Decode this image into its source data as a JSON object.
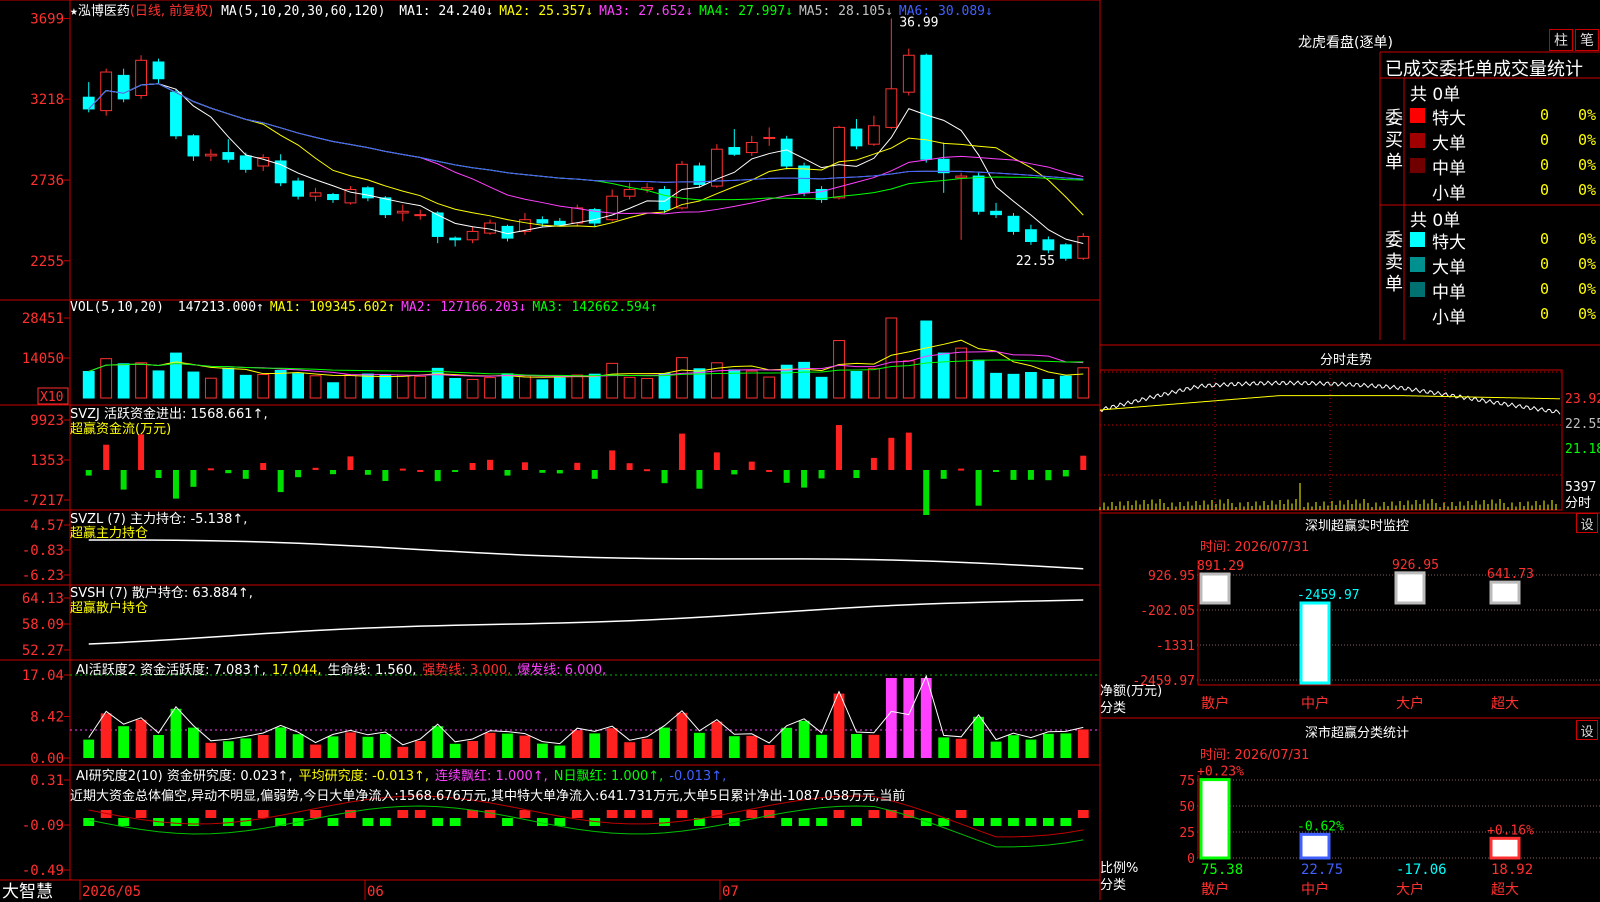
{
  "app_name": "大智慧",
  "main_chart": {
    "title_star": "★",
    "stock_name": "泓博医药",
    "period": "(日线, 前复权)",
    "ma_label": "MA(5,10,20,30,60,120)",
    "ma_values": [
      {
        "label": "MA1: 24.240↓",
        "color": "#ffffff"
      },
      {
        "label": "MA2: 25.357↓",
        "color": "#ffff00"
      },
      {
        "label": "MA3: 27.652↓",
        "color": "#ff40ff"
      },
      {
        "label": "MA4: 27.997↓",
        "color": "#00ff00"
      },
      {
        "label": "MA5: 28.105↓",
        "color": "#c0c0c0"
      },
      {
        "label": "MA6: 30.089↓",
        "color": "#4060ff"
      }
    ],
    "y_ticks": [
      "3699",
      "3218",
      "2736",
      "2255"
    ],
    "high_marker": "36.99",
    "low_marker": "22.55"
  },
  "volume_panel": {
    "label": "VOL(5,10,20)",
    "values": [
      {
        "label": "147213.000↑",
        "color": "#ffffff"
      },
      {
        "label": "MA1: 109345.602↑",
        "color": "#ffff00"
      },
      {
        "label": "MA2: 127166.203↓",
        "color": "#ff40ff"
      },
      {
        "label": "MA3: 142662.594↑",
        "color": "#00ff00"
      }
    ],
    "y_ticks": [
      "28451",
      "14050"
    ],
    "unit_badge": "X10"
  },
  "svzj_panel": {
    "label": "SVZJ  活跃资金进出: 1568.661↑,",
    "sub": "超赢资金流(万元)",
    "y_ticks": [
      "9923",
      "1353",
      "-7217"
    ]
  },
  "svzl_panel": {
    "label": "SVZL (7) 主力持仓: -5.138↑,",
    "sub": "超赢主力持仓",
    "y_ticks": [
      "4.57",
      "-0.83",
      "-6.23"
    ]
  },
  "svsh_panel": {
    "label": "SVSH (7) 散户持仓: 63.884↑,",
    "sub": "超赢散户持仓",
    "y_ticks": [
      "64.13",
      "58.09",
      "52.27"
    ]
  },
  "ai_active_panel": {
    "parts": [
      {
        "label": "AI活跃度2 资金活跃度: 7.083↑,",
        "color": "#ffffff"
      },
      {
        "label": "17.044,",
        "color": "#ffff00"
      },
      {
        "label": "生命线: 1.560,",
        "color": "#ffffff"
      },
      {
        "label": "强势线: 3.000,",
        "color": "#ff3030"
      },
      {
        "label": "爆发线: 6.000,",
        "color": "#ff40ff"
      }
    ],
    "y_ticks": [
      "17.04",
      "8.42",
      "0.00"
    ]
  },
  "ai_research_panel": {
    "parts": [
      {
        "label": "AI研究度2(10) 资金研究度: 0.023↑,",
        "color": "#ffffff"
      },
      {
        "label": "平均研究度: -0.013↑,",
        "color": "#ffff00"
      },
      {
        "label": "连续飘红: 1.000↑,",
        "color": "#ff40ff"
      },
      {
        "label": "N日飘红: 1.000↑,",
        "color": "#00ff00"
      },
      {
        "label": "-0.013↑,",
        "color": "#4060ff"
      }
    ],
    "desc": "近期大资金总体偏空,异动不明显,偏弱势,今日大单净流入:1568.676万元,其中特大单净流入:641.731万元,大单5日累计净出-1087.058万元,当前",
    "y_ticks": [
      "0.31",
      "-0.09",
      "-0.49"
    ]
  },
  "date_axis": [
    "2026/05",
    "06",
    "07"
  ],
  "right_panel": {
    "header": "龙虎看盘(逐单)",
    "tabs": [
      "柱",
      "笔"
    ],
    "stats_header": "已成交委托单成交量统计",
    "buy_label": "委买单",
    "sell_label": "委卖单",
    "buy_total": "共 0单",
    "sell_total": "共 0单",
    "buy_rows": [
      {
        "name": "特大",
        "count": "0",
        "pct": "0%",
        "color": "#ff0000"
      },
      {
        "name": "大单",
        "count": "0",
        "pct": "0%",
        "color": "#a00000"
      },
      {
        "name": "中单",
        "count": "0",
        "pct": "0%",
        "color": "#700000"
      },
      {
        "name": "小单",
        "count": "0",
        "pct": "0%",
        "color": "#000000"
      }
    ],
    "sell_rows": [
      {
        "name": "特大",
        "count": "0",
        "pct": "0%",
        "color": "#00ffff"
      },
      {
        "name": "大单",
        "count": "0",
        "pct": "0%",
        "color": "#009090"
      },
      {
        "name": "中单",
        "count": "0",
        "pct": "0%",
        "color": "#007070"
      },
      {
        "name": "小单",
        "count": "0",
        "pct": "0%",
        "color": "#000000"
      }
    ],
    "intraday_title": "分时走势",
    "intraday_ticks": [
      "23.92",
      "22.55",
      "21.18",
      "5397",
      "分时"
    ],
    "monitor_title": "深圳超赢实时监控",
    "monitor_btn": "设",
    "monitor_date": "时间: 2026/07/31",
    "monitor_ticks": [
      "926.95",
      "-202.05",
      "-1331",
      "-2459.97"
    ],
    "monitor_bars": [
      {
        "cat": "散户",
        "value": "891.29"
      },
      {
        "cat": "中户",
        "value": "-2459.97"
      },
      {
        "cat": "大户",
        "value": "926.95"
      },
      {
        "cat": "超大",
        "value": "641.73"
      }
    ],
    "monitor_ylabel": "净额(万元)",
    "monitor_xlabel": "分类",
    "class_title": "深市超赢分类统计",
    "class_btn": "设",
    "class_date": "时间: 2026/07/31",
    "class_ticks": [
      "75",
      "50",
      "25",
      "0"
    ],
    "class_bars": [
      {
        "cat": "散户",
        "pct": "+0.23%",
        "value": "75.38"
      },
      {
        "cat": "中户",
        "pct": "-0.62%",
        "value": "22.75"
      },
      {
        "cat": "大户",
        "pct": "",
        "value": "-17.06"
      },
      {
        "cat": "超大",
        "pct": "+0.16%",
        "value": "18.92"
      }
    ],
    "class_ylabel": "比例%",
    "class_xlabel": "分类"
  },
  "chart_data": {
    "type": "candlestick",
    "title": "泓博医药 (日线, 前复权)",
    "ylim": [
      22.55,
      36.99
    ],
    "candles": [
      [
        32.3,
        31.6,
        33.2,
        31.4
      ],
      [
        31.5,
        33.8,
        34.0,
        31.2
      ],
      [
        33.6,
        32.2,
        34.0,
        32.0
      ],
      [
        32.4,
        34.5,
        34.8,
        32.2
      ],
      [
        34.4,
        33.4,
        34.6,
        33.1
      ],
      [
        32.6,
        30.0,
        32.8,
        29.8
      ],
      [
        30.0,
        28.8,
        30.1,
        28.5
      ],
      [
        28.8,
        28.9,
        29.2,
        28.5
      ],
      [
        29.0,
        28.6,
        29.8,
        28.4
      ],
      [
        28.8,
        28.0,
        29.0,
        27.8
      ],
      [
        28.2,
        28.7,
        28.9,
        27.9
      ],
      [
        28.5,
        27.2,
        28.9,
        27.0
      ],
      [
        27.3,
        26.4,
        27.5,
        26.2
      ],
      [
        26.4,
        26.6,
        26.9,
        26.1
      ],
      [
        26.5,
        26.2,
        26.6,
        26.0
      ],
      [
        26.0,
        26.8,
        27.0,
        25.9
      ],
      [
        26.9,
        26.3,
        27.0,
        26.1
      ],
      [
        26.3,
        25.3,
        26.4,
        25.1
      ],
      [
        25.4,
        25.5,
        25.9,
        24.9
      ],
      [
        25.3,
        25.3,
        25.6,
        25.0
      ],
      [
        25.4,
        24.0,
        25.5,
        23.6
      ],
      [
        23.9,
        23.8,
        24.0,
        23.4
      ],
      [
        23.8,
        24.3,
        24.6,
        23.6
      ],
      [
        24.2,
        24.8,
        25.0,
        24.1
      ],
      [
        24.6,
        23.9,
        24.7,
        23.7
      ],
      [
        24.3,
        25.0,
        25.4,
        24.1
      ],
      [
        25.0,
        24.8,
        25.2,
        24.6
      ],
      [
        24.9,
        24.7,
        25.1,
        24.6
      ],
      [
        24.8,
        25.7,
        25.9,
        24.6
      ],
      [
        25.6,
        24.8,
        25.7,
        24.6
      ],
      [
        25.0,
        26.4,
        26.8,
        24.9
      ],
      [
        26.4,
        26.8,
        27.2,
        26.2
      ],
      [
        26.8,
        26.9,
        27.2,
        26.6
      ],
      [
        26.8,
        25.6,
        27.0,
        25.4
      ],
      [
        25.7,
        28.3,
        28.5,
        25.6
      ],
      [
        28.2,
        27.1,
        28.4,
        26.9
      ],
      [
        27.0,
        29.2,
        29.5,
        26.9
      ],
      [
        29.3,
        28.9,
        30.4,
        28.8
      ],
      [
        29.0,
        29.6,
        30.0,
        28.8
      ],
      [
        29.9,
        29.9,
        30.5,
        29.4
      ],
      [
        29.8,
        28.2,
        30.0,
        28.0
      ],
      [
        28.2,
        26.6,
        28.4,
        26.4
      ],
      [
        26.8,
        26.2,
        27.0,
        26.0
      ],
      [
        26.3,
        30.5,
        30.6,
        26.2
      ],
      [
        30.4,
        29.4,
        31.0,
        29.2
      ],
      [
        29.5,
        30.6,
        31.2,
        29.4
      ],
      [
        30.5,
        32.8,
        36.99,
        30.4
      ],
      [
        32.6,
        34.8,
        35.2,
        32.4
      ],
      [
        34.8,
        28.6,
        34.9,
        28.4
      ],
      [
        28.6,
        27.8,
        29.6,
        26.6
      ],
      [
        27.5,
        27.6,
        27.8,
        23.8
      ],
      [
        27.6,
        25.5,
        27.8,
        25.3
      ],
      [
        25.5,
        25.3,
        26.0,
        25.1
      ],
      [
        25.2,
        24.3,
        25.4,
        24.1
      ],
      [
        24.4,
        23.7,
        24.7,
        23.5
      ],
      [
        23.8,
        23.2,
        24.0,
        23.0
      ],
      [
        23.5,
        22.7,
        23.6,
        22.55
      ],
      [
        22.7,
        24.0,
        24.2,
        22.6
      ]
    ]
  }
}
